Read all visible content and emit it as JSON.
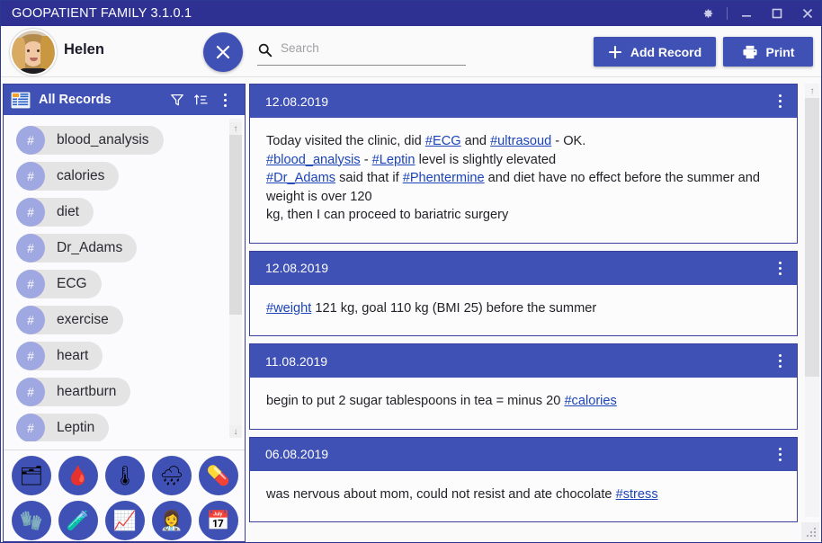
{
  "window": {
    "title": "GOOPATIENT FAMILY 3.1.0.1",
    "controls": {
      "settings": "gear-icon",
      "minimize": "minimize-icon",
      "maximize": "maximize-icon",
      "close": "close-icon"
    },
    "accent_color": "#3f51b5",
    "titlebar_color": "#2e3192"
  },
  "topbar": {
    "user_name": "Helen",
    "close_label": "×",
    "search": {
      "value": "",
      "placeholder": "Search"
    },
    "add_record_label": "Add Record",
    "add_record_icon": "plus-icon",
    "print_label": "Print",
    "print_icon": "printer-icon"
  },
  "sidebar": {
    "header": {
      "title": "All Records",
      "icon": "records-icon",
      "filter_icon": "filter-funnel-icon",
      "sort_icon": "sort-ascending-icon",
      "menu_icon": "kebab-menu-icon"
    },
    "tags": [
      {
        "hash": "#",
        "label": "blood_analysis"
      },
      {
        "hash": "#",
        "label": "calories"
      },
      {
        "hash": "#",
        "label": "diet"
      },
      {
        "hash": "#",
        "label": "Dr_Adams"
      },
      {
        "hash": "#",
        "label": "ECG"
      },
      {
        "hash": "#",
        "label": "exercise"
      },
      {
        "hash": "#",
        "label": "heart"
      },
      {
        "hash": "#",
        "label": "heartburn"
      },
      {
        "hash": "#",
        "label": "Leptin"
      }
    ],
    "scroll": {
      "up_arrow": "↑",
      "down_arrow": "↓"
    },
    "tray": [
      {
        "name": "records-icon",
        "glyph": "🗂"
      },
      {
        "name": "body-alert-icon",
        "glyph": "🩸"
      },
      {
        "name": "thermometer-icon",
        "glyph": "🌡"
      },
      {
        "name": "weather-icon",
        "glyph": "🌧"
      },
      {
        "name": "medication-icon",
        "glyph": "💊"
      },
      {
        "name": "glove-icon",
        "glyph": "🧤"
      },
      {
        "name": "flask-icon",
        "glyph": "🧪"
      },
      {
        "name": "chart-icon",
        "glyph": "📈"
      },
      {
        "name": "doctor-icon",
        "glyph": "👩‍⚕"
      },
      {
        "name": "calendar-icon",
        "glyph": "📅"
      }
    ]
  },
  "records": [
    {
      "date": "12.08.2019",
      "lines": [
        [
          {
            "t": "text",
            "v": "Today visited the clinic, did "
          },
          {
            "t": "tag",
            "v": "#ECG"
          },
          {
            "t": "text",
            "v": " and "
          },
          {
            "t": "tag",
            "v": "#ultrasoud"
          },
          {
            "t": "text",
            "v": " - OK."
          }
        ],
        [
          {
            "t": "tag",
            "v": "#blood_analysis"
          },
          {
            "t": "text",
            "v": " - "
          },
          {
            "t": "tag",
            "v": "#Leptin"
          },
          {
            "t": "text",
            "v": " level is slightly elevated"
          }
        ],
        [
          {
            "t": "tag",
            "v": "#Dr_Adams"
          },
          {
            "t": "text",
            "v": " said that if "
          },
          {
            "t": "tag",
            "v": "#Phentermine"
          },
          {
            "t": "text",
            "v": " and diet have no effect before the summer and weight is over 120"
          }
        ],
        [
          {
            "t": "text",
            "v": "kg, then I can proceed to bariatric surgery"
          }
        ]
      ]
    },
    {
      "date": "12.08.2019",
      "lines": [
        [
          {
            "t": "tag",
            "v": "#weight"
          },
          {
            "t": "text",
            "v": " 121 kg, goal 110 kg (BMI 25) before the summer"
          }
        ]
      ]
    },
    {
      "date": "11.08.2019",
      "lines": [
        [
          {
            "t": "text",
            "v": "begin to put 2 sugar tablespoons in tea = minus 20 "
          },
          {
            "t": "tag",
            "v": "#calories"
          }
        ]
      ]
    },
    {
      "date": "06.08.2019",
      "lines": [
        [
          {
            "t": "text",
            "v": "was nervous about mom, could not resist and ate chocolate "
          },
          {
            "t": "tag",
            "v": "#stress"
          }
        ]
      ]
    }
  ],
  "main_scroll": {
    "up_arrow": "↑"
  }
}
